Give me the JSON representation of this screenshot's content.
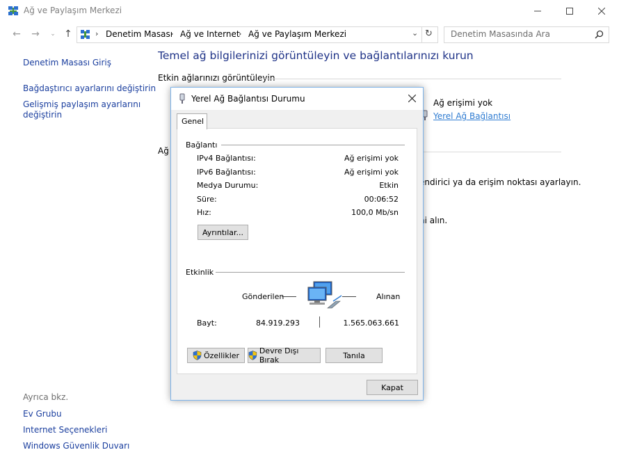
{
  "window": {
    "title": "Ağ ve Paylaşım Merkezi",
    "icon": "network-center-icon"
  },
  "address": {
    "breadcrumb": [
      "Denetim Masası",
      "Ağ ve Internet",
      "Ağ ve Paylaşım Merkezi"
    ],
    "search_placeholder": "Denetim Masasında Ara"
  },
  "sidebar": {
    "home": "Denetim Masası Giriş",
    "links": [
      "Bağdaştırıcı ayarlarını değiştirin",
      "Gelişmiş paylaşım ayarlarını",
      "değiştirin"
    ],
    "see_also_label": "Ayrıca bkz.",
    "see_also": [
      "Ev Grubu",
      "Internet Seçenekleri",
      "Windows Güvenlik Duvarı"
    ]
  },
  "main": {
    "title": "Temel ağ bilgilerinizi görüntüleyin ve bağlantılarınızı kurun",
    "active_networks": "Etkin ağlarınızı görüntüleyin",
    "access_label": "Ağ erişimi yok",
    "connection_link": "Yerel Ağ Bağlantısı",
    "change_section": "Ağ",
    "partial_text1": "endirici ya da erişim noktası ayarlayın.",
    "partial_text2": "ni alın."
  },
  "dialog": {
    "title": "Yerel Ağ Bağlantısı Durumu",
    "tab": "Genel",
    "connection_group": "Bağlantı",
    "rows": [
      {
        "label": "IPv4 Bağlantısı:",
        "value": "Ağ erişimi yok"
      },
      {
        "label": "IPv6 Bağlantısı:",
        "value": "Ağ erişimi yok"
      },
      {
        "label": "Medya Durumu:",
        "value": "Etkin"
      },
      {
        "label": "Süre:",
        "value": "00:06:52"
      },
      {
        "label": "Hız:",
        "value": "100,0 Mb/sn"
      }
    ],
    "details_button": "Ayrıntılar...",
    "activity_group": "Etkinlik",
    "sent_label": "Gönderilen",
    "received_label": "Alınan",
    "bytes_label": "Bayt:",
    "bytes_sent": "84.919.293",
    "bytes_received": "1.565.063.661",
    "buttons": {
      "properties": "Özellikler",
      "disable": "Devre Dışı Bırak",
      "diagnose": "Tanıla"
    },
    "close_button": "Kapat"
  },
  "colors": {
    "link": "#1a3e9e",
    "title": "#1e3287",
    "dialog_border": "#7eb4ea",
    "access_link": "#2e7bd1"
  }
}
